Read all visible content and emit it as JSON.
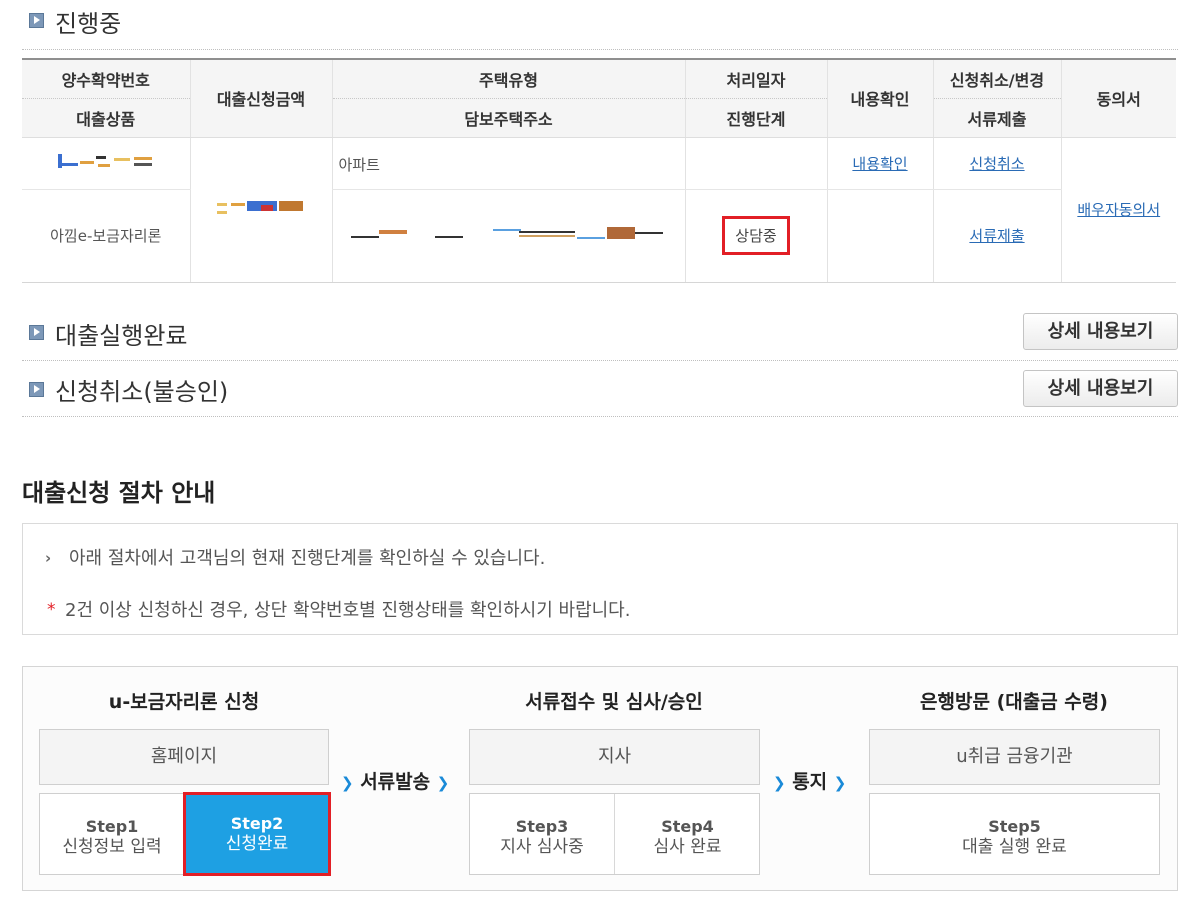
{
  "sections": {
    "in_progress": "진행중",
    "loan_done": "대출실행완료",
    "cancelled": "신청취소(불승인)",
    "detail_button": "상세 내용보기"
  },
  "table": {
    "headers": {
      "contract_no": "양수확약번호",
      "product": "대출상품",
      "amount": "대출신청금액",
      "house_type": "주택유형",
      "address": "담보주택주소",
      "process_date": "처리일자",
      "stage": "진행단계",
      "content_check": "내용확인",
      "cancel_change": "신청취소/변경",
      "doc_submit": "서류제출",
      "consent": "동의서"
    },
    "row": {
      "product": "아낌e-보금자리론",
      "house_type": "아파트",
      "stage": "상담중",
      "content_link": "내용확인",
      "cancel_link": "신청취소",
      "doc_link": "서류제출",
      "consent_link": "배우자동의서"
    }
  },
  "guide": {
    "title": "대출신청 절차 안내",
    "line1": "아래 절차에서 고객님의 현재 진행단계를 확인하실 수 있습니다.",
    "line2": "2건 이상 신청하신 경우, 상단 확약번호별 진행상태를 확인하시기 바랍니다."
  },
  "flow": {
    "phase1": "u-보금자리론 신청",
    "phase2": "서류접수 및 심사/승인",
    "phase3": "은행방문 (대출금 수령)",
    "box1": "홈페이지",
    "box2": "지사",
    "box3": "u취급 금융기관",
    "arrow1": "서류발송",
    "arrow2": "통지",
    "steps": [
      {
        "num": "Step1",
        "label": "신청정보 입력"
      },
      {
        "num": "Step2",
        "label": "신청완료"
      },
      {
        "num": "Step3",
        "label": "지사 심사중"
      },
      {
        "num": "Step4",
        "label": "심사 완료"
      },
      {
        "num": "Step5",
        "label": "대출 실행 완료"
      }
    ],
    "active_step": "Step2"
  },
  "colors": {
    "accent_blue": "#1ea0e3",
    "highlight_red": "#e21f26",
    "link_blue": "#2a6bb5"
  }
}
